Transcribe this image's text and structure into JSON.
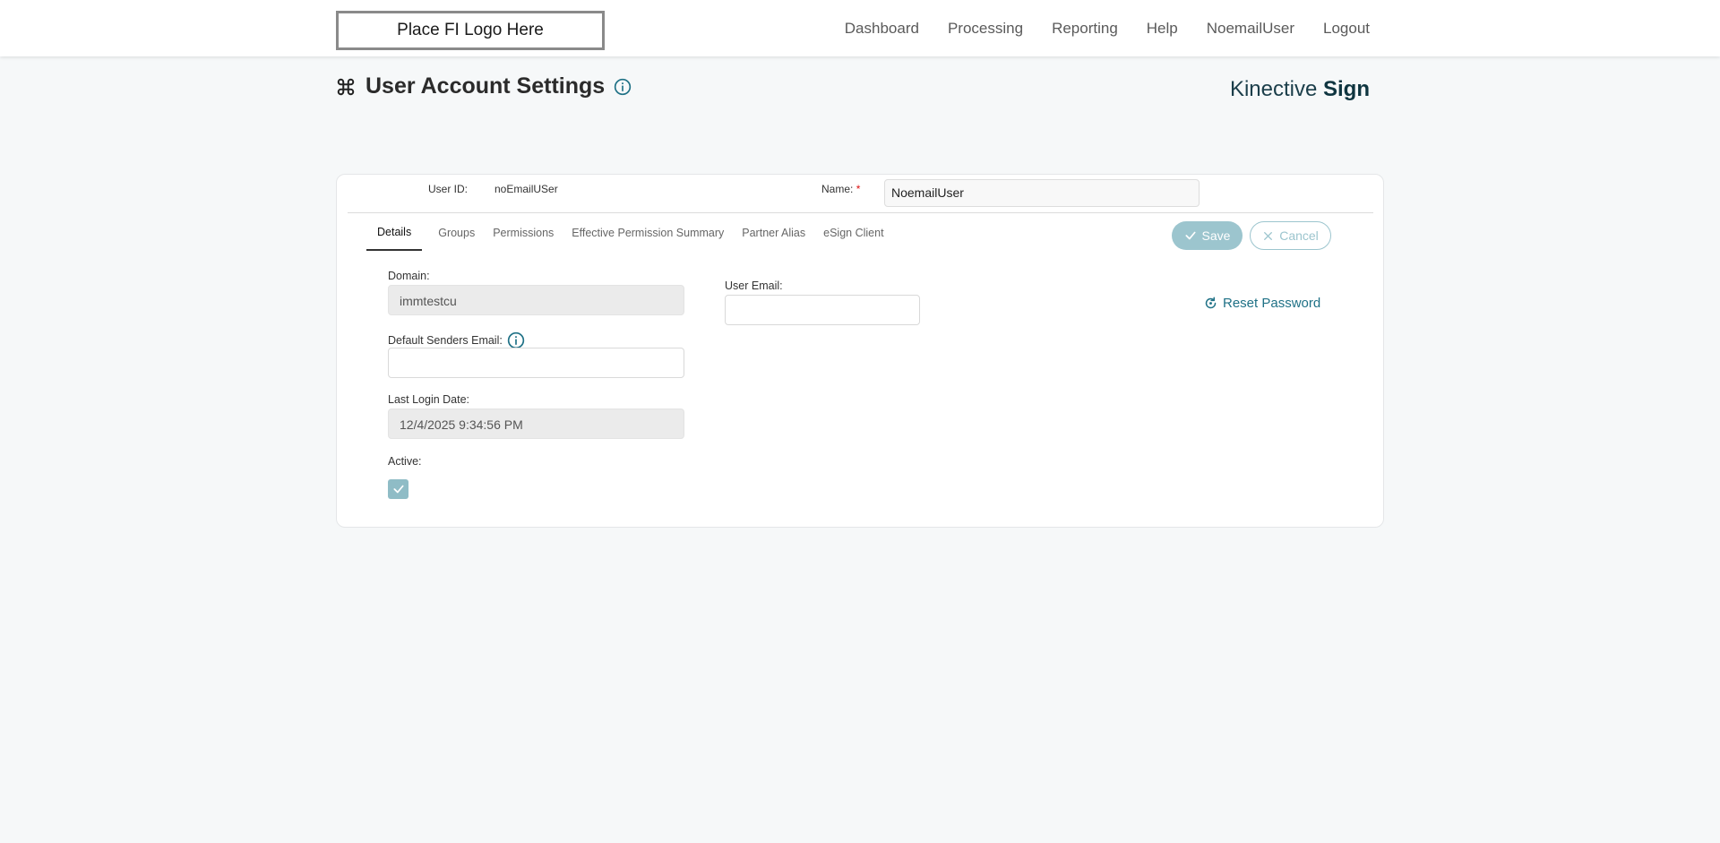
{
  "header": {
    "logo_text": "Place FI Logo Here",
    "nav": [
      "Dashboard",
      "Processing",
      "Reporting",
      "Help",
      "NoemailUser",
      "Logout"
    ]
  },
  "page": {
    "title": "User Account Settings",
    "brand_light": "Kinective",
    "brand_bold": "Sign"
  },
  "form": {
    "user_id_label": "User ID:",
    "user_id_value": "noEmailUSer",
    "name_label": "Name:",
    "name_required": "*",
    "name_value": "NoemailUser"
  },
  "tabs": [
    "Details",
    "Groups",
    "Permissions",
    "Effective Permission Summary",
    "Partner Alias",
    "eSign Client"
  ],
  "actions": {
    "save_label": "Save",
    "cancel_label": "Cancel",
    "reset_password_label": "Reset Password"
  },
  "details": {
    "domain_label": "Domain:",
    "domain_value": "immtestcu",
    "default_senders_email_label": "Default Senders Email:",
    "default_senders_email_value": "",
    "last_login_label": "Last Login Date:",
    "last_login_value": "12/4/2025 9:34:56 PM",
    "active_label": "Active:",
    "active_checked": true,
    "user_email_label": "User Email:",
    "user_email_value": ""
  },
  "colors": {
    "accent": "#1f7186",
    "button_fill": "#9cc5ce",
    "checkbox_fill": "#8fbcc6"
  }
}
